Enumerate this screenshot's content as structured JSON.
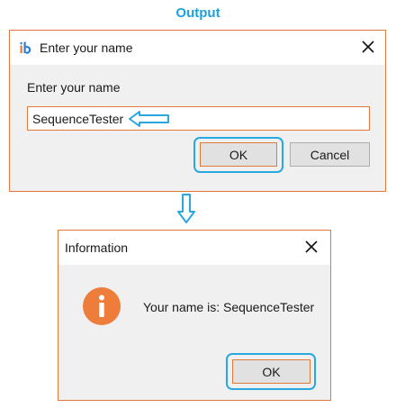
{
  "heading": "Output",
  "input_dialog": {
    "title": "Enter your name",
    "prompt": "Enter your name",
    "input_value": "SequenceTester",
    "ok_label": "OK",
    "cancel_label": "Cancel",
    "app_icon": "ib-app-logo-icon",
    "close_icon": "close-icon"
  },
  "info_dialog": {
    "title": "Information",
    "message": "Your name is: SequenceTester",
    "ok_label": "OK",
    "icon": "info-icon",
    "close_icon": "close-icon"
  },
  "annotations": {
    "arrow_left_icon": "arrow-left-icon",
    "arrow_down_icon": "arrow-down-icon",
    "highlight_color": "#29a8e0",
    "accent_color": "#e07a3a"
  }
}
